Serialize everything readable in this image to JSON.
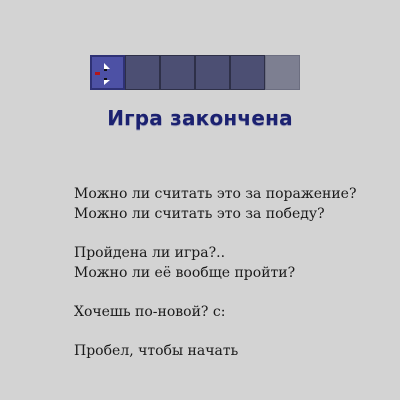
{
  "board": {
    "cells": [
      "head",
      "body",
      "body",
      "body",
      "body",
      "empty"
    ]
  },
  "title": "Игра закончена",
  "paragraphs": [
    [
      "Можно ли считать это за поражение?",
      "Можно ли считать это за победу?"
    ],
    [
      "Пройдена ли игра?..",
      "Можно ли её вообще пройти?"
    ],
    [
      "Хочешь по-новой? c:"
    ],
    [
      "Пробел, чтобы начать"
    ]
  ],
  "colors": {
    "background": "#d3d3d3",
    "title": "#1b2170",
    "snake_body": "#4c4f73",
    "snake_head": "#4d51a5",
    "empty_cell": "#7d7f91"
  },
  "icons": {
    "head": "snake-head-icon"
  }
}
